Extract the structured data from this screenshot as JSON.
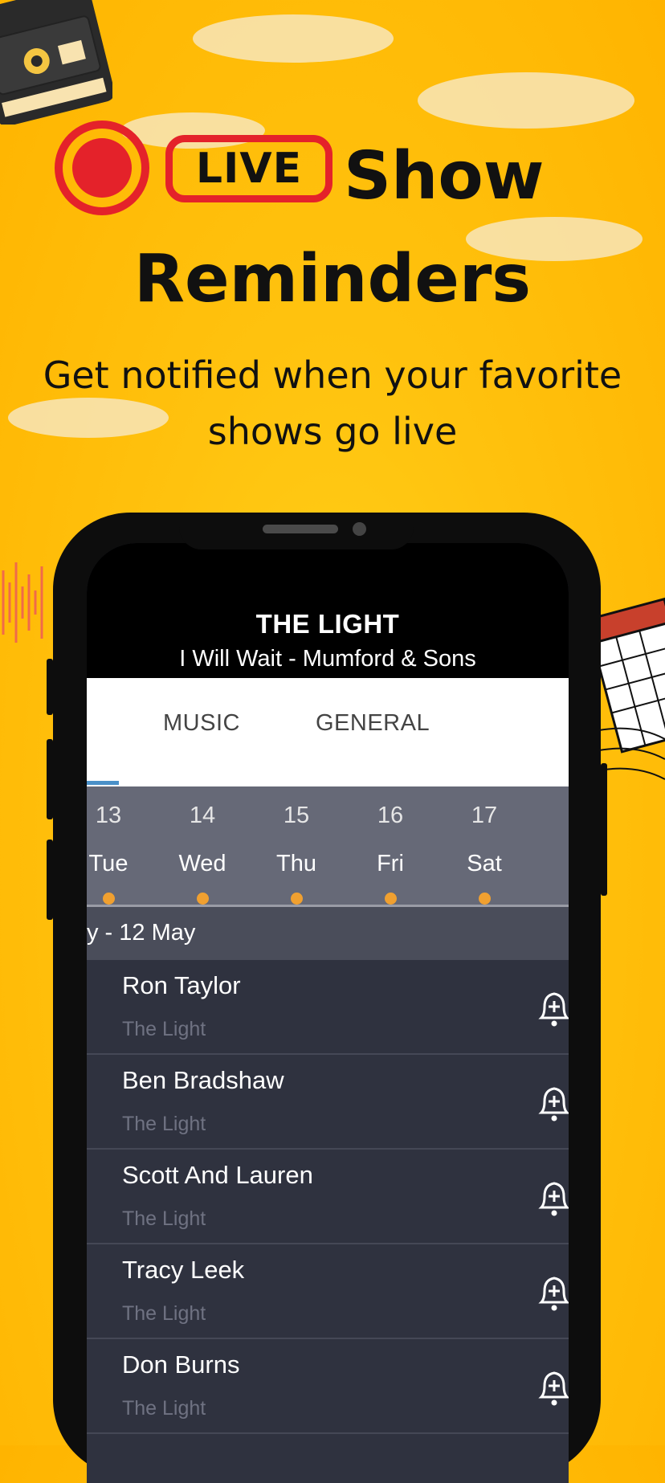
{
  "hero": {
    "live_label": "LIVE",
    "show_word": "Show",
    "reminders_word": "Reminders",
    "subtitle_line1": "Get notified when your favorite",
    "subtitle_line2": "shows go live"
  },
  "app": {
    "station": "THE LIGHT",
    "now_playing": "I Will Wait - Mumford & Sons",
    "tabs": [
      {
        "label": "MUSIC"
      },
      {
        "label": "GENERAL"
      }
    ],
    "days": [
      {
        "num": "13",
        "name": "Tue"
      },
      {
        "num": "14",
        "name": "Wed"
      },
      {
        "num": "15",
        "name": "Thu"
      },
      {
        "num": "16",
        "name": "Fri"
      },
      {
        "num": "17",
        "name": "Sat"
      }
    ],
    "date_header": "y - 12 May",
    "shows": [
      {
        "host": "Ron Taylor",
        "station": "The Light"
      },
      {
        "host": "Ben Bradshaw",
        "station": "The Light"
      },
      {
        "host": "Scott And Lauren",
        "station": "The Light"
      },
      {
        "host": "Tracy Leek",
        "station": "The Light"
      },
      {
        "host": "Don Burns",
        "station": "The Light"
      }
    ]
  },
  "colors": {
    "background": "#ffc20e",
    "live_red": "#e4222a",
    "tab_indicator": "#4a90c8",
    "day_dot": "#f0a030"
  },
  "icons": [
    "record-icon",
    "bell-plus-icon",
    "cassette-icon",
    "calendar-icon"
  ]
}
